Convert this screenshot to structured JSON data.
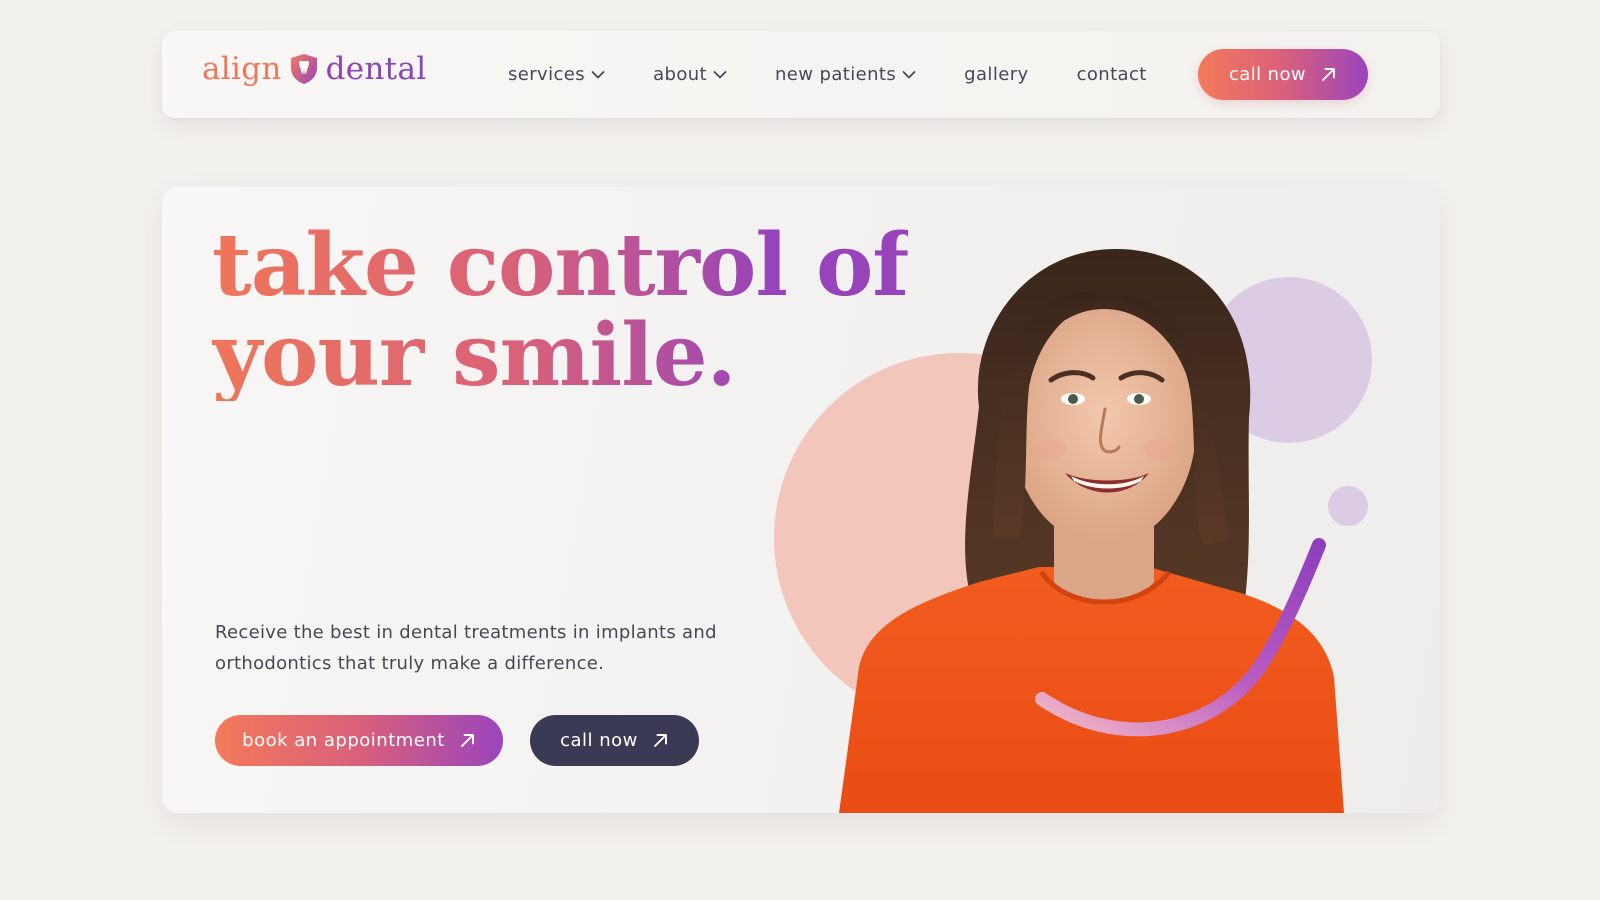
{
  "brand": {
    "name_part1": "align",
    "name_part2": "dental",
    "logo_icon": "tooth-shield-icon",
    "colors": {
      "coral": "#f47a5b",
      "pink": "#d9607a",
      "purple": "#9b45bd",
      "dark": "#3b3a55"
    }
  },
  "nav": {
    "items": [
      {
        "label": "services",
        "has_dropdown": true
      },
      {
        "label": "about",
        "has_dropdown": true
      },
      {
        "label": "new patients",
        "has_dropdown": true
      },
      {
        "label": "gallery",
        "has_dropdown": false
      },
      {
        "label": "contact",
        "has_dropdown": false
      }
    ],
    "cta_label": "call now",
    "cta_icon": "arrow-up-right-icon"
  },
  "hero": {
    "headline_line1": "take control of",
    "headline_line2": "your smile.",
    "subtext": "Receive the best in dental treatments in implants and orthodontics that truly make a difference.",
    "primary_button": "book an appointment",
    "secondary_button": "call now",
    "button_icon": "arrow-up-right-icon",
    "image": "smiling-woman-orange-shirt"
  }
}
